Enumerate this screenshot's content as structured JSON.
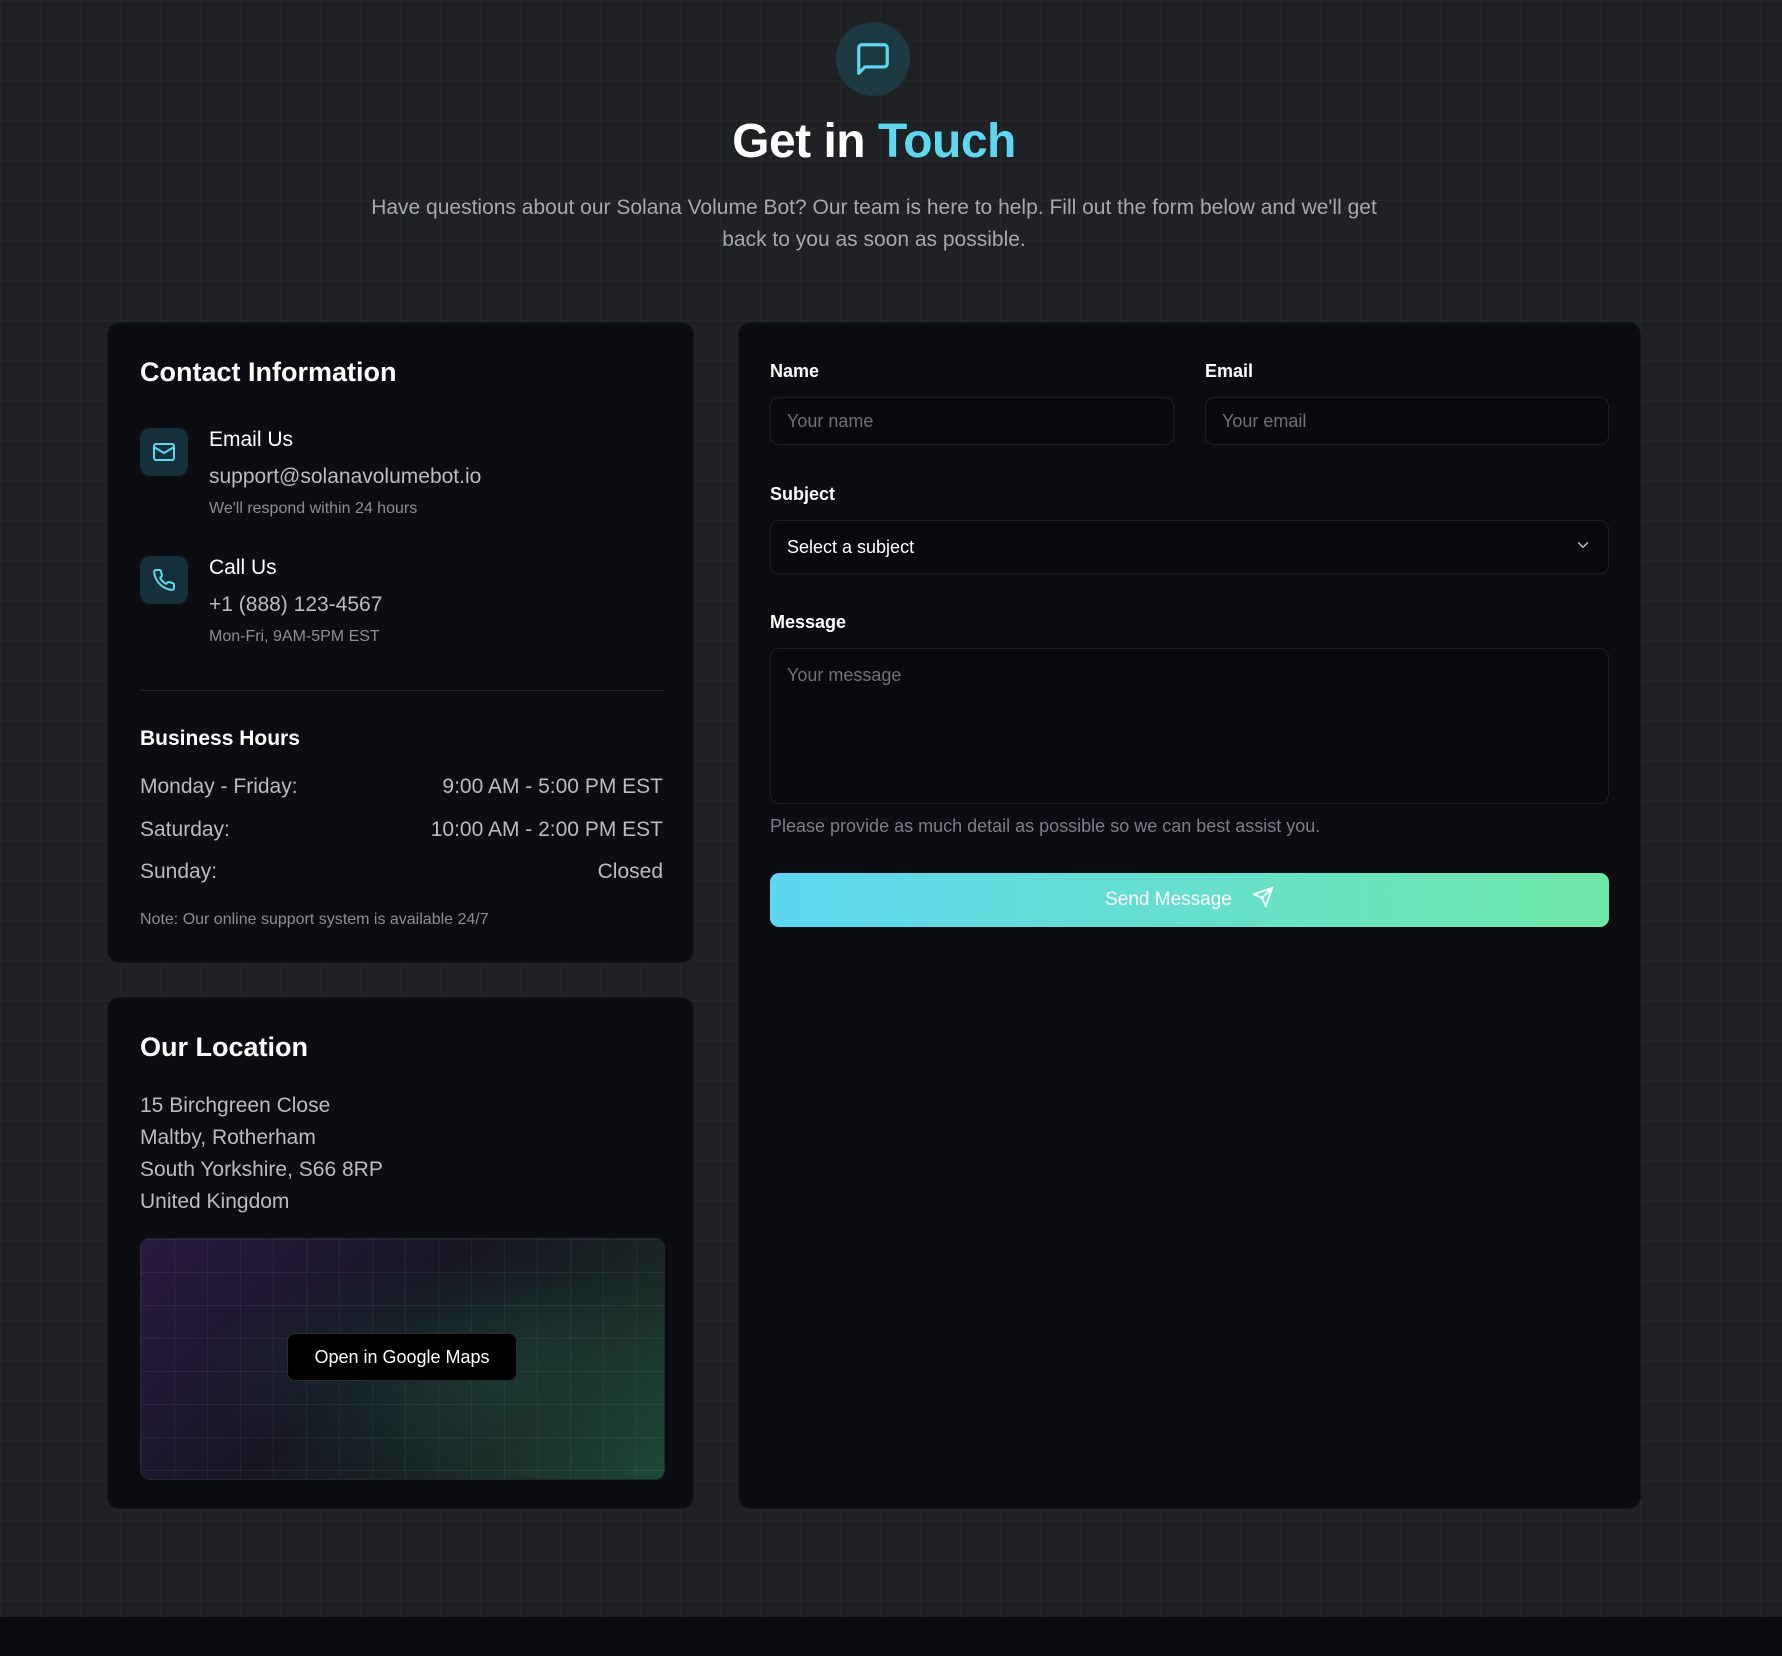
{
  "header": {
    "icon": "message-square-icon",
    "title_main": "Get in ",
    "title_accent": "Touch",
    "subtitle": "Have questions about our Solana Volume Bot? Our team is here to help. Fill out the form below and we'll get back to you as soon as possible."
  },
  "contact": {
    "title": "Contact Information",
    "email": {
      "icon": "mail-icon",
      "label": "Email Us",
      "value": "support@solanavolumebot.io",
      "note": "We'll respond within 24 hours"
    },
    "phone": {
      "icon": "phone-icon",
      "label": "Call Us",
      "value": "+1 (888) 123-4567",
      "note": "Mon-Fri, 9AM-5PM EST"
    },
    "hours": {
      "title": "Business Hours",
      "rows": [
        {
          "day": "Monday - Friday:",
          "time": "9:00 AM - 5:00 PM EST"
        },
        {
          "day": "Saturday:",
          "time": "10:00 AM - 2:00 PM EST"
        },
        {
          "day": "Sunday:",
          "time": "Closed"
        }
      ],
      "note": "Note: Our online support system is available 24/7"
    }
  },
  "location": {
    "title": "Our Location",
    "address": [
      "15 Birchgreen Close",
      "Maltby, Rotherham",
      "South Yorkshire, S66 8RP",
      "United Kingdom"
    ],
    "map_button": "Open in Google Maps"
  },
  "form": {
    "name_label": "Name",
    "name_placeholder": "Your name",
    "email_label": "Email",
    "email_placeholder": "Your email",
    "subject_label": "Subject",
    "subject_value": "Select a subject",
    "message_label": "Message",
    "message_placeholder": "Your message",
    "help_text": "Please provide as much detail as possible so we can best assist you.",
    "submit_label": "Send Message",
    "submit_icon": "send-icon"
  },
  "colors": {
    "accent": "#5ed8f0",
    "gradient_start": "#5ed6f2",
    "gradient_end": "#6ee8a8",
    "card_bg": "#0b0d13",
    "page_bg": "#202124"
  }
}
